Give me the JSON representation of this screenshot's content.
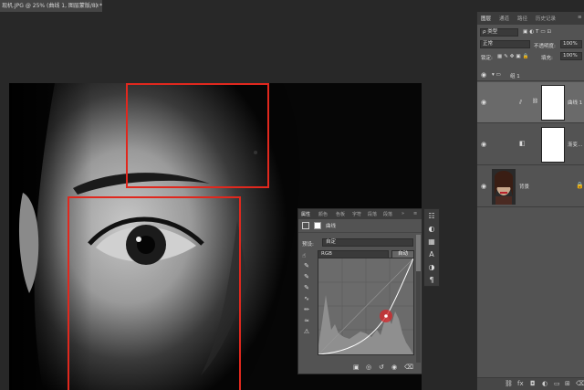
{
  "document": {
    "tab_title": "现机.JPG @ 25% (曲线 1, 图层蒙版/8) *",
    "close_glyph": "×"
  },
  "properties_panel": {
    "tabs": [
      "属性",
      "颜色",
      "色板",
      "字符",
      "段落",
      "段落"
    ],
    "adjustment_title": "曲线",
    "preset_label": "预设:",
    "preset_value": "自定",
    "channel_value": "RGB",
    "auto_button": "自动"
  },
  "layers_panel": {
    "tabs": [
      "图层",
      "通道",
      "路径",
      "历史记录"
    ],
    "filter_kind": "ρ 类型",
    "blend_mode": "正常",
    "opacity_label": "不透明度:",
    "opacity_value": "100%",
    "lock_label": "锁定:",
    "fill_label": "填充:",
    "fill_value": "100%",
    "group_name": "组 1",
    "layers": [
      {
        "name": "曲线 1"
      },
      {
        "name": "渐变..."
      },
      {
        "name": "背景"
      }
    ]
  },
  "colors": {
    "selection_red": "#e0281e",
    "panel_bg": "#535353",
    "workspace_bg": "#282828"
  }
}
